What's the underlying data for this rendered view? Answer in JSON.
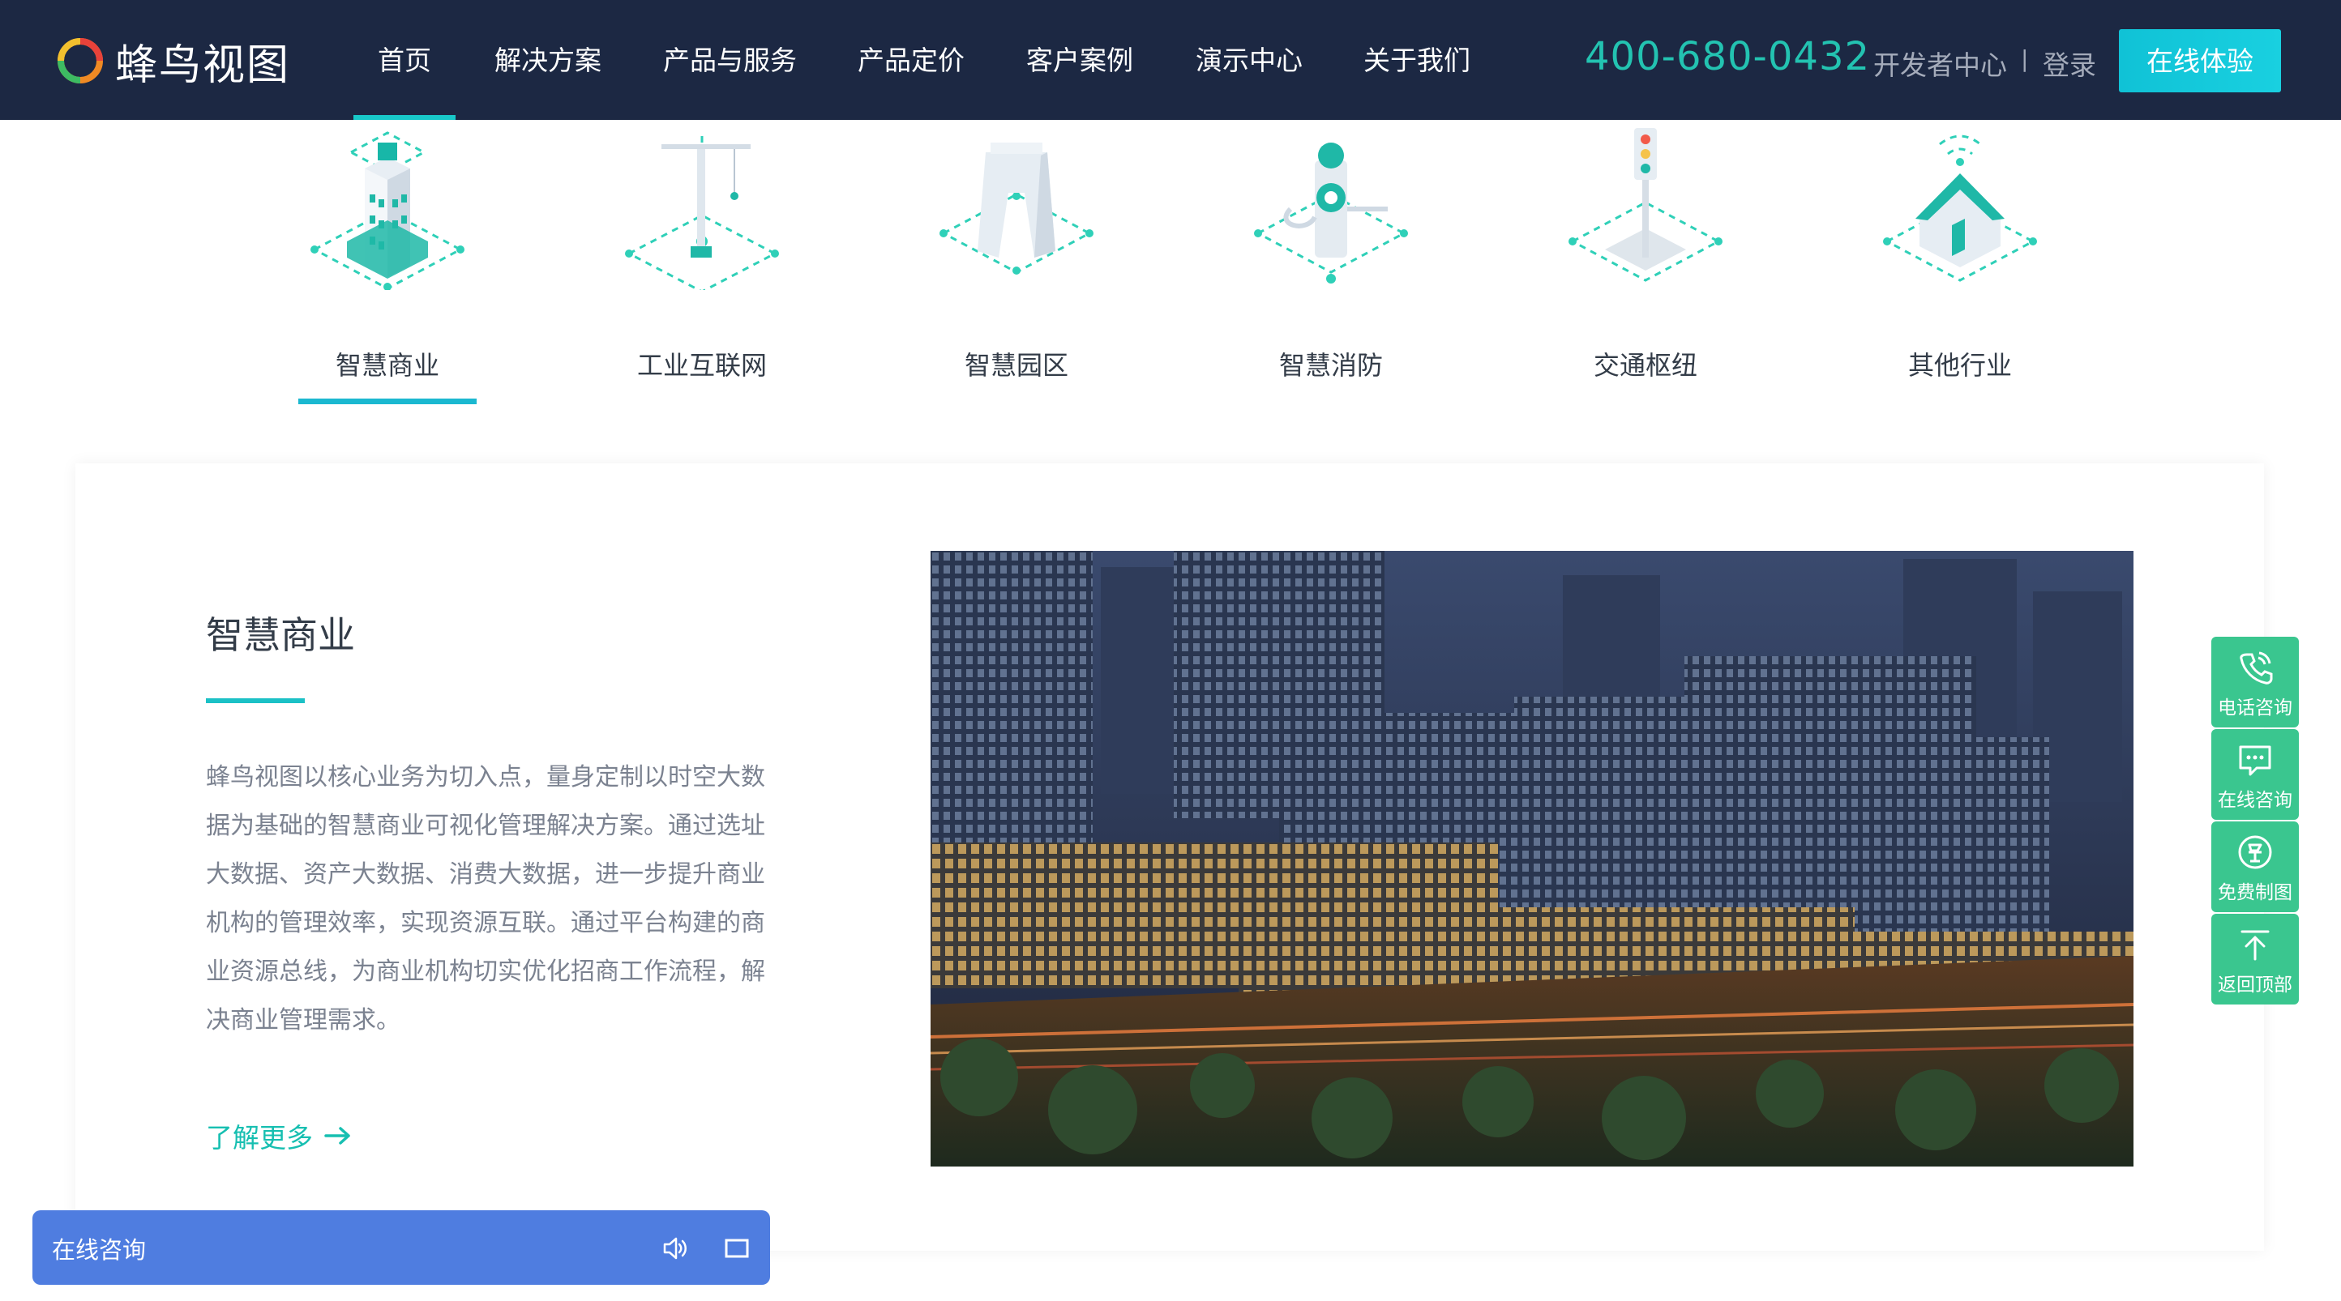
{
  "header": {
    "logo_text": "蜂鸟视图",
    "nav": [
      {
        "label": "首页"
      },
      {
        "label": "解决方案"
      },
      {
        "label": "产品与服务"
      },
      {
        "label": "产品定价"
      },
      {
        "label": "客户案例"
      },
      {
        "label": "演示中心"
      },
      {
        "label": "关于我们"
      }
    ],
    "active_nav": "首页",
    "phone": "400-680-0432",
    "developer_link": "开发者中心",
    "separator": "|",
    "login_link": "登录",
    "try_button": "在线体验"
  },
  "industries": [
    {
      "label": "智慧商业",
      "icon": "office-building-icon"
    },
    {
      "label": "工业互联网",
      "icon": "tower-crane-icon"
    },
    {
      "label": "智慧园区",
      "icon": "park-gate-icon"
    },
    {
      "label": "智慧消防",
      "icon": "fire-hydrant-icon"
    },
    {
      "label": "交通枢纽",
      "icon": "traffic-light-icon"
    },
    {
      "label": "其他行业",
      "icon": "smart-home-icon"
    }
  ],
  "active_industry": "智慧商业",
  "detail": {
    "title": "智慧商业",
    "lines": [
      "蜂鸟视图以核心业务为切入点，量身定制以时空大数",
      "据为基础的智慧商业可视化管理解决方案。通过选址",
      "大数据、资产大数据、消费大数据，进一步提升商业",
      "机构的管理效率，实现资源互联。通过平台构建的商",
      "业资源总线，为商业机构切实优化招商工作流程，解",
      "决商业管理需求。"
    ],
    "more_link": "了解更多"
  },
  "side_tools": [
    {
      "label": "电话咨询",
      "icon": "phone-icon"
    },
    {
      "label": "在线咨询",
      "icon": "chat-bubble-icon"
    },
    {
      "label": "免费制图",
      "icon": "free-badge-icon"
    },
    {
      "label": "返回顶部",
      "icon": "back-to-top-icon"
    }
  ],
  "chat_bar": {
    "label": "在线咨询"
  },
  "colors": {
    "header_bg": "#1c2843",
    "accent_teal": "#18c8c9",
    "phone_green": "#23c3b1",
    "side_tool_green": "#3ac68f",
    "chat_blue": "#4f7de0"
  }
}
